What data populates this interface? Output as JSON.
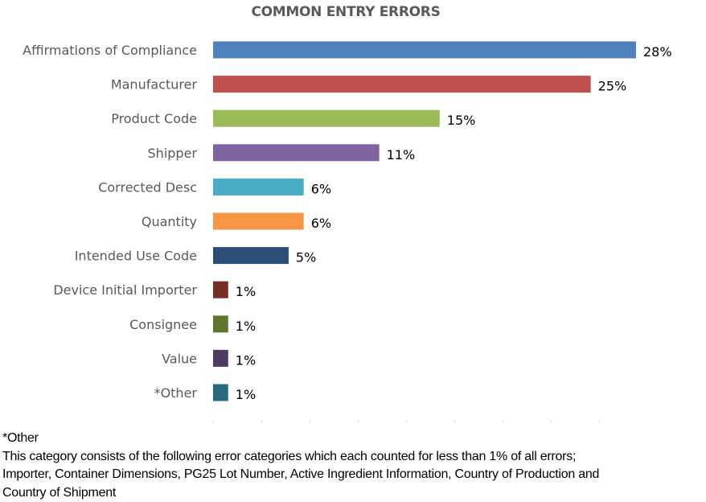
{
  "chart_data": {
    "type": "bar",
    "orientation": "horizontal",
    "title": "COMMON ENTRY ERRORS",
    "xlabel": "",
    "ylabel": "",
    "xlim": [
      0,
      28
    ],
    "grid": false,
    "legend": "none",
    "value_suffix": "%",
    "categories": [
      "Affirmations of Compliance",
      "Manufacturer",
      "Product Code",
      "Shipper",
      "Corrected Desc",
      "Quantity",
      "Intended Use Code",
      "Device Initial Importer",
      "Consignee",
      "Value",
      "*Other"
    ],
    "values": [
      28,
      25,
      15,
      11,
      6,
      6,
      5,
      1,
      1,
      1,
      1
    ],
    "data_labels": [
      "28%",
      "25%",
      "15%",
      "11%",
      "6%",
      "6%",
      "5%",
      "1%",
      "1%",
      "1%",
      "1%"
    ],
    "colors": [
      "#4f81bd",
      "#c0504d",
      "#9bbb59",
      "#8064a2",
      "#4bacc6",
      "#f79646",
      "#2c4d75",
      "#772c2a",
      "#5f7530",
      "#4d3b62",
      "#276a7c"
    ]
  },
  "footnote": {
    "heading": "*Other",
    "lines": [
      "This category consists of the following error categories which each counted for less than 1% of all errors;",
      "Importer, Container Dimensions, PG25 Lot Number, Active Ingredient Information, Country of Production and",
      "Country of Shipment"
    ]
  }
}
